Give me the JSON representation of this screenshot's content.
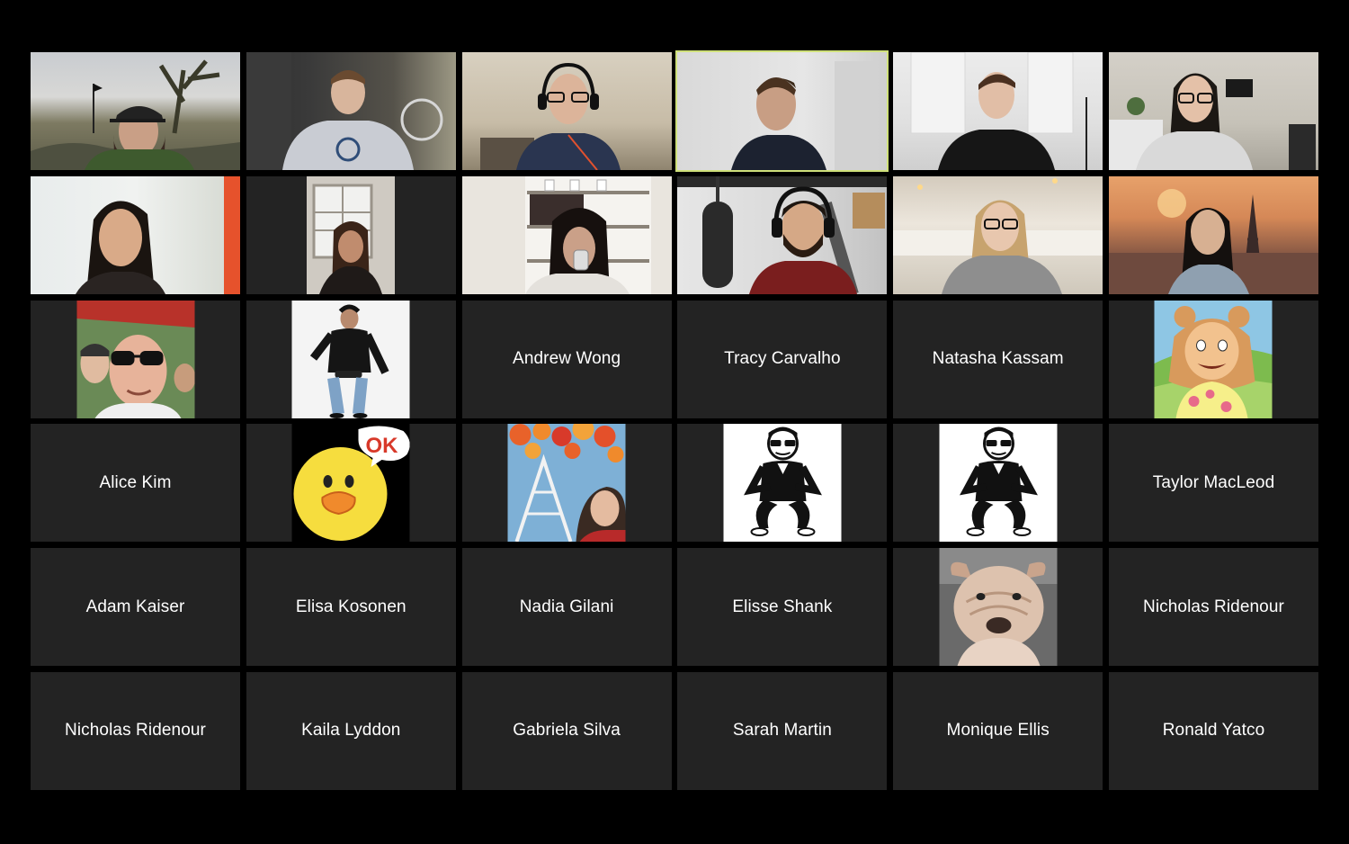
{
  "gallery": {
    "active_speaker_color": "#cfe07a",
    "tile_background": "#232323",
    "participants": [
      {
        "kind": "video",
        "icon": "video-feed-desert-cap",
        "name": ""
      },
      {
        "kind": "video",
        "icon": "video-feed-hoodie",
        "name": ""
      },
      {
        "kind": "video",
        "icon": "video-feed-headphones-glasses",
        "name": ""
      },
      {
        "kind": "video",
        "icon": "video-feed-active-speaker",
        "name": "",
        "active": true
      },
      {
        "kind": "video",
        "icon": "video-feed-kitchen",
        "name": ""
      },
      {
        "kind": "video",
        "icon": "video-feed-glasses-woman",
        "name": ""
      },
      {
        "kind": "video",
        "icon": "video-feed-woman-speaking",
        "name": ""
      },
      {
        "kind": "video",
        "icon": "video-feed-window",
        "name": ""
      },
      {
        "kind": "video",
        "icon": "video-feed-drinking",
        "name": ""
      },
      {
        "kind": "video",
        "icon": "video-feed-podcast-mic",
        "name": ""
      },
      {
        "kind": "video",
        "icon": "video-feed-blonde-glasses",
        "name": ""
      },
      {
        "kind": "video",
        "icon": "video-feed-paris-background",
        "name": ""
      },
      {
        "kind": "avatar",
        "icon": "avatar-selfie-sunglasses",
        "name": ""
      },
      {
        "kind": "avatar",
        "icon": "avatar-fashion-pose",
        "name": ""
      },
      {
        "kind": "name",
        "name": "Andrew Wong"
      },
      {
        "kind": "name",
        "name": "Tracy Carvalho"
      },
      {
        "kind": "name",
        "name": "Natasha Kassam"
      },
      {
        "kind": "avatar",
        "icon": "avatar-cartoon-aardvark",
        "name": ""
      },
      {
        "kind": "name",
        "name": "Alice Kim"
      },
      {
        "kind": "avatar",
        "icon": "avatar-duck-ok-sticker",
        "name": ""
      },
      {
        "kind": "avatar",
        "icon": "avatar-space-needle-photo",
        "name": ""
      },
      {
        "kind": "avatar",
        "icon": "avatar-dancer-cartoon",
        "name": ""
      },
      {
        "kind": "avatar",
        "icon": "avatar-dancer-cartoon",
        "name": ""
      },
      {
        "kind": "name",
        "name": "Taylor MacLeod"
      },
      {
        "kind": "name",
        "name": "Adam Kaiser"
      },
      {
        "kind": "name",
        "name": "Elisa Kosonen"
      },
      {
        "kind": "name",
        "name": "Nadia Gilani"
      },
      {
        "kind": "name",
        "name": "Elisse Shank"
      },
      {
        "kind": "avatar",
        "icon": "avatar-bulldog-puppy",
        "name": ""
      },
      {
        "kind": "name",
        "name": "Nicholas Ridenour"
      },
      {
        "kind": "name",
        "name": "Nicholas Ridenour"
      },
      {
        "kind": "name",
        "name": "Kaila Lyddon"
      },
      {
        "kind": "name",
        "name": "Gabriela Silva"
      },
      {
        "kind": "name",
        "name": "Sarah Martin"
      },
      {
        "kind": "name",
        "name": "Monique Ellis"
      },
      {
        "kind": "name",
        "name": "Ronald Yatco"
      }
    ]
  },
  "ok_sticker_text": "OK"
}
